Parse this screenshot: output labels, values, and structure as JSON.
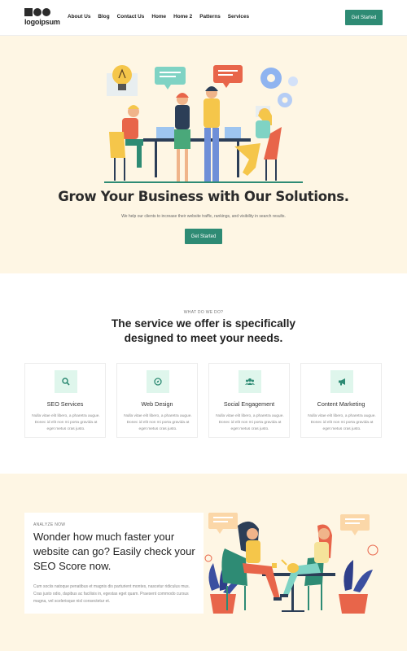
{
  "header": {
    "logo_text": "logoipsum",
    "nav": [
      "About Us",
      "Blog",
      "Contact Us",
      "Home",
      "Home 2",
      "Patterns",
      "Services"
    ],
    "cta_label": "Get Started"
  },
  "hero": {
    "title": "Grow Your Business with Our Solutions.",
    "subtitle": "We help our clients to increase their website traffic, rankings, and visibility in search results.",
    "cta_label": "Get Started"
  },
  "services": {
    "eyebrow": "WHAT DO WE DO?",
    "title": "The service we offer is specifically designed to meet your needs.",
    "cards": [
      {
        "icon": "search-icon",
        "title": "SEO Services",
        "text": "Nulla vitae elit libero, a pharetra augue. Donec id elit non mi porta gravida at eget metus cras justo."
      },
      {
        "icon": "compass-icon",
        "title": "Web Design",
        "text": "Nulla vitae elit libero, a pharetra augue. Donec id elit non mi porta gravida at eget metus cras justo."
      },
      {
        "icon": "users-icon",
        "title": "Social Engagement",
        "text": "Nulla vitae elit libero, a pharetra augue. Donec id elit non mi porta gravida at eget metus cras justo."
      },
      {
        "icon": "megaphone-icon",
        "title": "Content Marketing",
        "text": "Nulla vitae elit libero, a pharetra augue. Donec id elit non mi porta gravida at eget metus cras justo."
      }
    ]
  },
  "analyze": {
    "eyebrow": "ANALYZE NOW",
    "title": "Wonder how much faster your website can go? Easily check your SEO Score now.",
    "text": "Cum sociis natoque penatibus et magnis dis parturient montes, nascetur ridiculus mus. Cras justo odio, dapibus ac facilisis in, egestas eget quam. Praesent commodo cursus magna, vel scelerisque nisl consectetur et."
  },
  "colors": {
    "accent": "#2e8b74",
    "cream": "#fef6e4",
    "icon_bg": "#dff6ec"
  }
}
